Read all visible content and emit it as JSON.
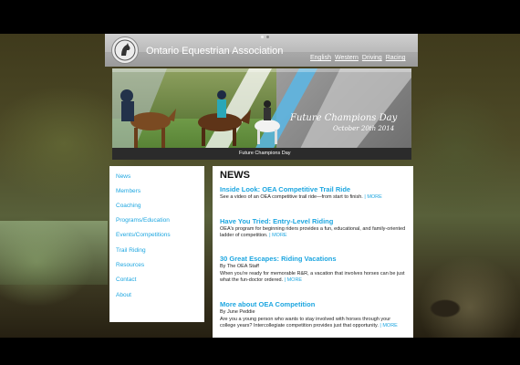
{
  "header": {
    "org_name": "Ontario Equestrian Association",
    "links": [
      "English",
      "Western",
      "Driving",
      "Racing"
    ]
  },
  "banner": {
    "title": "Future Champions Day",
    "date": "October 20th 2014",
    "caption": "Future Champions Day"
  },
  "sidebar": {
    "items": [
      "News",
      "Members",
      "Coaching",
      "Programs/Education",
      "Events/Competitions",
      "Trail Riding",
      "Resources",
      "Contact",
      "About"
    ]
  },
  "content": {
    "heading": "NEWS",
    "posts": [
      {
        "title": "Inside Look: OEA Competitive Trail Ride",
        "byline": "",
        "text": "See a video of an OEA competitive trail ride—from start to finish.",
        "more": "| MORE"
      },
      {
        "title": "Have You Tried: Entry-Level Riding",
        "byline": "",
        "text": "OEA's program for beginning riders provides a fun, educational, and family-oriented ladder of competition.",
        "more": "| MORE"
      },
      {
        "title": "30 Great Escapes: Riding Vacations",
        "byline": "By The OEA Staff",
        "text": "When you're ready for memorable R&R, a vacation that involves horses can be just what the fun-doctor ordered.",
        "more": "| MORE"
      },
      {
        "title": "More about OEA Competition",
        "byline": "By June Peddie",
        "text": "Are you a young person who wants to stay involved with horses through your college years? Intercollegiate competition provides just that opportunity.",
        "more": "| MORE"
      }
    ]
  },
  "colors": {
    "link": "#1da6e0",
    "header_gray": "#a8a8a8",
    "caption_bar": "#2b2b2b"
  }
}
